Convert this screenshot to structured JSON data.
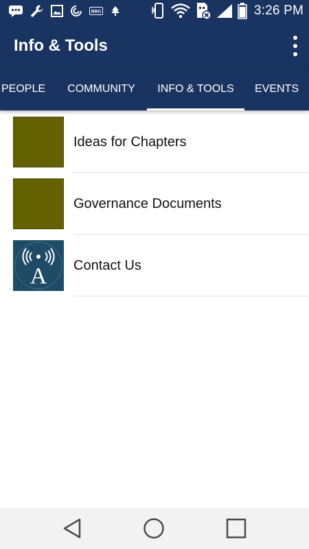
{
  "status_bar": {
    "time": "3:26 PM",
    "left_icons": [
      "chat-icon",
      "wrench-icon",
      "image-icon",
      "sync-icon",
      "bbg-icon",
      "tree-icon"
    ],
    "right_icons": [
      "vibrate-icon",
      "wifi-icon",
      "sim-icon",
      "signal-icon",
      "battery-icon"
    ],
    "bbg_text": "BBG"
  },
  "toolbar": {
    "title": "Info & Tools",
    "menu_icon": "overflow-menu-icon"
  },
  "tabs": [
    {
      "label": "PEOPLE",
      "selected": false
    },
    {
      "label": "COMMUNITY",
      "selected": false
    },
    {
      "label": "INFO & TOOLS",
      "selected": true
    },
    {
      "label": "EVENTS",
      "selected": false
    }
  ],
  "list": {
    "items": [
      {
        "label": "Ideas for Chapters",
        "thumb_color": "#636100"
      },
      {
        "label": "Governance Documents",
        "thumb_color": "#636100"
      },
      {
        "label": "Contact Us",
        "thumb_color": "#1f4b66",
        "thumb_icon": "radio-tower-icon",
        "thumb_letter": "A"
      }
    ]
  },
  "nav_bar": {
    "buttons": [
      "back-icon",
      "home-icon",
      "recent-apps-icon"
    ]
  },
  "colors": {
    "primary": "#1a3461",
    "olive": "#636100",
    "contact_bg": "#1f4b66",
    "nav_bg": "#f2f2f2"
  }
}
